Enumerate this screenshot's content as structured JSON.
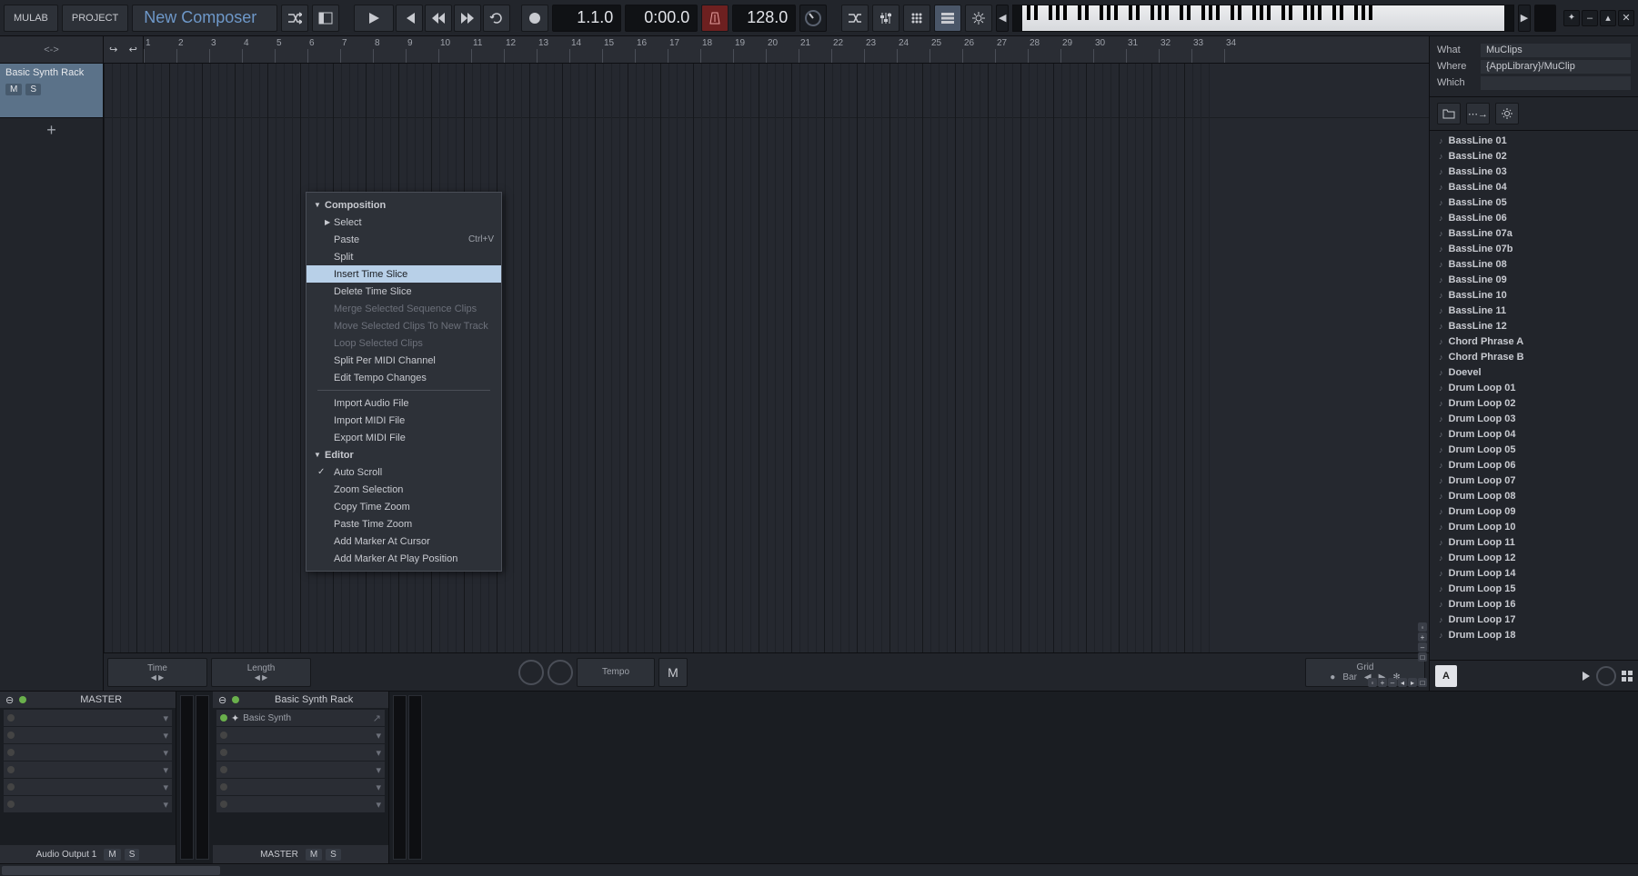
{
  "topbar": {
    "mulab_label": "MULAB",
    "project_label": "PROJECT",
    "title": "New Composer",
    "position": "1.1.0",
    "time": "0:00.0",
    "tempo": "128.0"
  },
  "tracks_head": "<->",
  "track": {
    "name": "Basic Synth Rack",
    "mute": "M",
    "solo": "S"
  },
  "add_track": "+",
  "ruler_start": 1,
  "ruler_end": 34,
  "infobar": {
    "time_label": "Time",
    "length_label": "Length",
    "tempo_label": "Tempo",
    "marker": "M",
    "grid_label": "Grid",
    "grid_value": "Bar"
  },
  "browser": {
    "what_label": "What",
    "what_value": "MuClips",
    "where_label": "Where",
    "where_value": "{AppLibrary}/MuClip",
    "which_label": "Which",
    "which_value": "",
    "items": [
      "BassLine 01",
      "BassLine 02",
      "BassLine 03",
      "BassLine 04",
      "BassLine 05",
      "BassLine 06",
      "BassLine 07a",
      "BassLine 07b",
      "BassLine 08",
      "BassLine 09",
      "BassLine 10",
      "BassLine 11",
      "BassLine 12",
      "Chord Phrase A",
      "Chord Phrase B",
      "Doevel",
      "Drum Loop 01",
      "Drum Loop 02",
      "Drum Loop 03",
      "Drum Loop 04",
      "Drum Loop 05",
      "Drum Loop 06",
      "Drum Loop 07",
      "Drum Loop 08",
      "Drum Loop 09",
      "Drum Loop 10",
      "Drum Loop 11",
      "Drum Loop 12",
      "Drum Loop 14",
      "Drum Loop 15",
      "Drum Loop 16",
      "Drum Loop 17",
      "Drum Loop 18"
    ],
    "a_button": "A"
  },
  "mixer": {
    "master_label": "MASTER",
    "track_label": "Basic Synth Rack",
    "slot_synth": "Basic Synth",
    "output_label": "Audio Output 1",
    "m": "M",
    "s": "S"
  },
  "ctxmenu": {
    "composition": "Composition",
    "select": "Select",
    "paste": "Paste",
    "paste_short": "Ctrl+V",
    "split": "Split",
    "insert_time": "Insert Time Slice",
    "delete_time": "Delete Time Slice",
    "merge": "Merge Selected Sequence Clips",
    "move": "Move Selected Clips To New Track",
    "loop": "Loop Selected Clips",
    "split_midi": "Split Per MIDI Channel",
    "edit_tempo": "Edit Tempo Changes",
    "import_audio": "Import Audio File",
    "import_midi": "Import MIDI File",
    "export_midi": "Export MIDI File",
    "editor": "Editor",
    "auto_scroll": "Auto Scroll",
    "zoom_sel": "Zoom Selection",
    "copy_zoom": "Copy Time Zoom",
    "paste_zoom": "Paste Time Zoom",
    "add_marker_cursor": "Add Marker At Cursor",
    "add_marker_play": "Add Marker At Play Position"
  }
}
